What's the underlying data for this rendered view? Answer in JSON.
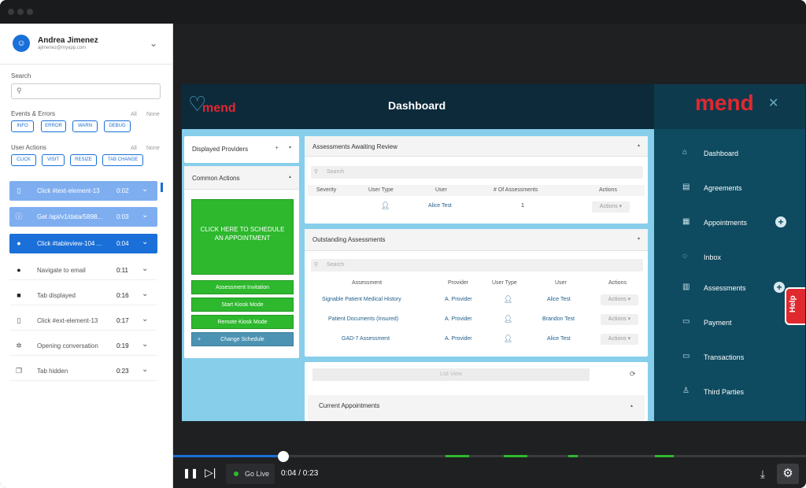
{
  "user": {
    "name": "Andrea Jimenez",
    "email": "ajimenez@myapp.com"
  },
  "search": {
    "label": "Search",
    "placeholder": ""
  },
  "events_errors": {
    "label": "Events & Errors",
    "all": "All",
    "none": "None",
    "filters": [
      "INFO",
      "ERROR",
      "WARN",
      "DEBUG"
    ]
  },
  "user_actions": {
    "label": "User Actions",
    "all": "All",
    "none": "None",
    "filters": [
      "CLICK",
      "VISIT",
      "RESIZE",
      "TAB CHANGE"
    ]
  },
  "events": [
    {
      "text": "Click #text-element-13",
      "time": "0:02",
      "icon": "mouse-icon"
    },
    {
      "text": "Get /api/v1/data/5898...",
      "time": "0:03",
      "icon": "info-icon"
    },
    {
      "text": "Click #tableview-104 ...",
      "time": "0:04",
      "icon": "record-icon"
    },
    {
      "text": "Navigate to email",
      "time": "0:11",
      "icon": "navigate-icon"
    },
    {
      "text": "Tab displayed",
      "time": "0:16",
      "icon": "tab-icon"
    },
    {
      "text": "Click #ext-element-13",
      "time": "0:17",
      "icon": "mouse-icon"
    },
    {
      "text": "Opening conversation",
      "time": "0:19",
      "icon": "bug-icon"
    },
    {
      "text": "Tab hidden",
      "time": "0:23",
      "icon": "tab-icon"
    }
  ],
  "app": {
    "header_title": "Dashboard",
    "logo_text": "mend",
    "brand_logo": "mend",
    "help": "Help",
    "panels": {
      "displayed_providers": "Displayed Providers",
      "common_actions": "Common Actions",
      "big_button": "CLICK HERE TO SCHEDULE AN APPOINTMENT",
      "buttons": [
        "Assessment Invitation",
        "Start Kiosk Mode",
        "Remote Kiosk Mode"
      ],
      "change_schedule": "Change Schedule"
    },
    "awaiting": {
      "title": "Assessments Awaiting Review",
      "search": "Search",
      "headers": [
        "Severity",
        "User Type",
        "User",
        "# Of Assessments",
        "Actions"
      ],
      "rows": [
        {
          "user": "Alice Test",
          "count": "1",
          "actions": "Actions ▾"
        }
      ]
    },
    "outstanding": {
      "title": "Outstanding Assessments",
      "search": "Search",
      "headers": [
        "Assessment",
        "Provider",
        "User Type",
        "User",
        "Actions"
      ],
      "rows": [
        {
          "assessment": "Signable Patient Medical History",
          "provider": "A. Provider",
          "user": "Alice Test",
          "actions": "Actions ▾"
        },
        {
          "assessment": "Patient Documents (Insured)",
          "provider": "A. Provider",
          "user": "Brandon Test",
          "actions": "Actions ▾"
        },
        {
          "assessment": "GAD-7 Assessment",
          "provider": "A. Provider",
          "user": "Alice Test",
          "actions": "Actions ▾"
        }
      ]
    },
    "list_view": "List View",
    "current_appointments": "Current Appointments",
    "nav": [
      "Dashboard",
      "Agreements",
      "Appointments",
      "Inbox",
      "Assessments",
      "Payment",
      "Transactions",
      "Third Parties"
    ]
  },
  "player": {
    "go_live": "Go Live",
    "time": "0:04 / 0:23",
    "progress": 0.174
  }
}
